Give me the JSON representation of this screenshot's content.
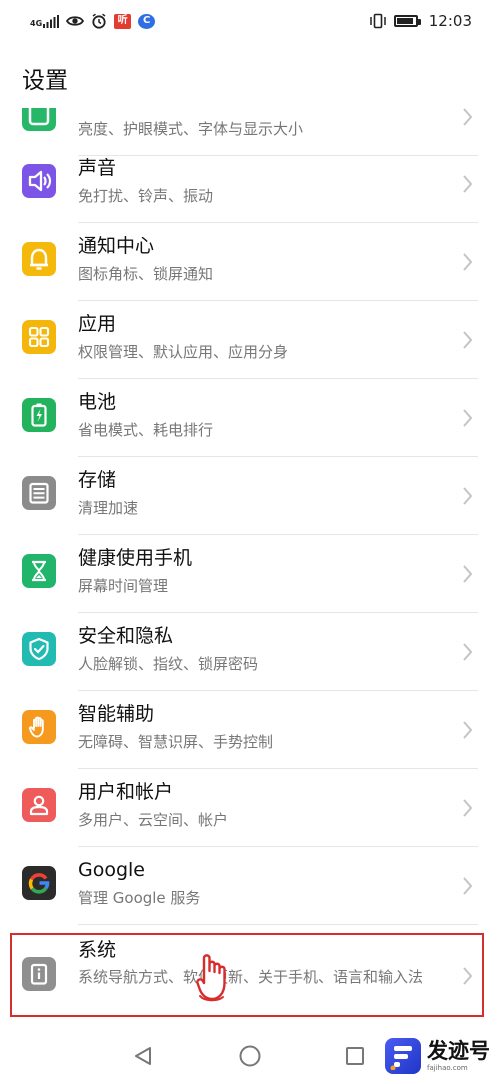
{
  "status_bar": {
    "network": "4G",
    "badge_red": "听",
    "badge_blue": "C",
    "time": "12:03"
  },
  "header": {
    "title": "设置"
  },
  "colors": {
    "display": "#27b769",
    "sound": "#7d55e6",
    "notification": "#f5b90b",
    "apps": "#f4b60b",
    "battery": "#23b35c",
    "storage": "#8b8b8b",
    "digital_balance": "#20b56b",
    "security": "#22bbb2",
    "assistance": "#f59a1e",
    "accounts": "#ef5a5a",
    "google": "#2b2b2b",
    "system": "#8f8f8f",
    "highlight": "#d72d2d"
  },
  "settings": {
    "items": [
      {
        "id": "display",
        "title": "",
        "subtitle": "亮度、护眼模式、字体与显示大小",
        "icon": "display-icon"
      },
      {
        "id": "sound",
        "title": "声音",
        "subtitle": "免打扰、铃声、振动",
        "icon": "speaker-icon"
      },
      {
        "id": "notification",
        "title": "通知中心",
        "subtitle": "图标角标、锁屏通知",
        "icon": "bell-icon"
      },
      {
        "id": "apps",
        "title": "应用",
        "subtitle": "权限管理、默认应用、应用分身",
        "icon": "apps-grid-icon"
      },
      {
        "id": "battery",
        "title": "电池",
        "subtitle": "省电模式、耗电排行",
        "icon": "battery-icon"
      },
      {
        "id": "storage",
        "title": "存储",
        "subtitle": "清理加速",
        "icon": "storage-icon"
      },
      {
        "id": "digital_balance",
        "title": "健康使用手机",
        "subtitle": "屏幕时间管理",
        "icon": "hourglass-icon"
      },
      {
        "id": "security",
        "title": "安全和隐私",
        "subtitle": "人脸解锁、指纹、锁屏密码",
        "icon": "shield-icon"
      },
      {
        "id": "assistance",
        "title": "智能辅助",
        "subtitle": "无障碍、智慧识屏、手势控制",
        "icon": "hand-icon"
      },
      {
        "id": "accounts",
        "title": "用户和帐户",
        "subtitle": "多用户、云空间、帐户",
        "icon": "user-icon"
      },
      {
        "id": "google",
        "title": "Google",
        "subtitle": "管理 Google 服务",
        "icon": "google-icon"
      },
      {
        "id": "system",
        "title": "系统",
        "subtitle": "系统导航方式、软件更新、关于手机、语言和输入法",
        "icon": "system-icon"
      }
    ]
  },
  "watermark": {
    "title": "发迹号",
    "url": "fajihao.com"
  }
}
